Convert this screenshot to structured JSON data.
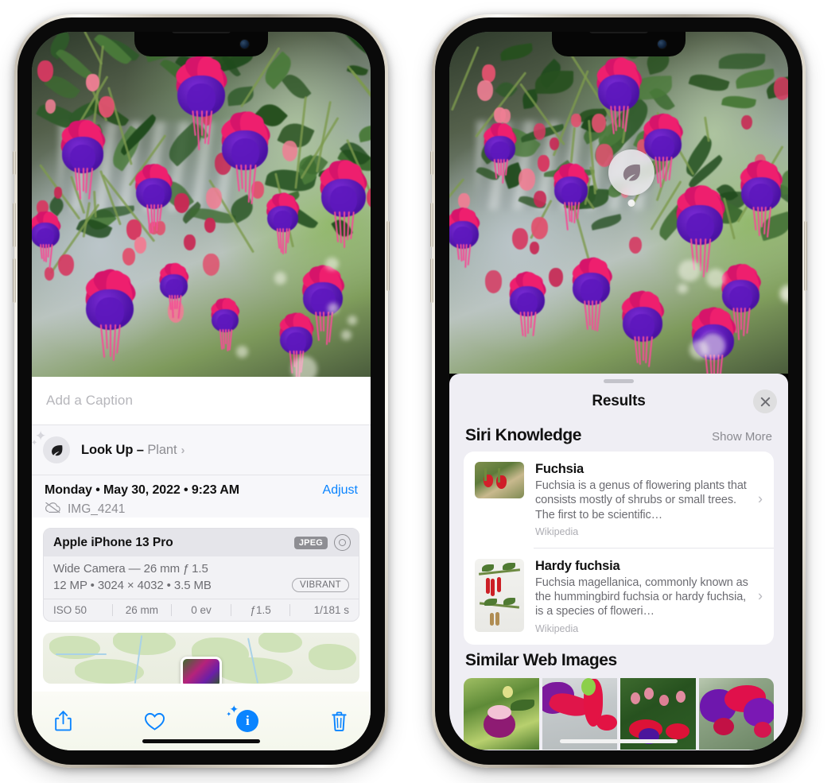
{
  "left_phone": {
    "name": "photos-info-view",
    "caption": {
      "placeholder": "Add a Caption",
      "value": ""
    },
    "lookup": {
      "label": "Look Up – ",
      "subject": "Plant",
      "chevron": "›",
      "icon": "leaf-icon"
    },
    "metadata": {
      "date": "Monday • May 30, 2022 • 9:23 AM",
      "adjust": "Adjust",
      "filename": "IMG_4241",
      "cloud_icon": "icloud-slash-icon"
    },
    "exif": {
      "model": "Apple iPhone 13 Pro",
      "format_tag": "JPEG",
      "aperture_icon": "aperture-icon",
      "lens_line": "Wide Camera — 26 mm ƒ 1.5",
      "size_line": "12 MP  •  3024 × 4032  •  3.5 MB",
      "style_tag": "VIBRANT",
      "stats": [
        "ISO 50",
        "26 mm",
        "0 ev",
        "ƒ1.5",
        "1/181 s"
      ]
    },
    "map": {
      "name": "location-map-thumbnail"
    },
    "toolbar": [
      {
        "name": "share-button",
        "icon": "share-icon"
      },
      {
        "name": "favorite-button",
        "icon": "heart-icon"
      },
      {
        "name": "info-button",
        "icon": "info-sparkle-icon",
        "glyph": "i"
      },
      {
        "name": "delete-button",
        "icon": "trash-icon"
      }
    ]
  },
  "right_phone": {
    "name": "visual-look-up-results",
    "badge": {
      "name": "leaf-subject-badge",
      "icon": "leaf-icon"
    },
    "sheet": {
      "title": "Results",
      "close_label": "×",
      "sections": [
        {
          "name": "siri-knowledge",
          "title": "Siri Knowledge",
          "action": "Show More",
          "items": [
            {
              "title": "Fuchsia",
              "description": "Fuchsia is a genus of flowering plants that consists mostly of shrubs or small trees. The first to be scientific…",
              "source": "Wikipedia",
              "thumb": "fuchsia-red-flowers-thumbnail"
            },
            {
              "title": "Hardy fuchsia",
              "description": "Fuchsia magellanica, commonly known as the hummingbird fuchsia or hardy fuchsia, is a species of floweri…",
              "source": "Wikipedia",
              "thumb": "hardy-fuchsia-branch-thumbnail"
            }
          ]
        },
        {
          "name": "similar-web-images",
          "title": "Similar Web Images",
          "images": [
            {
              "name": "web-image-1"
            },
            {
              "name": "web-image-2"
            },
            {
              "name": "web-image-3"
            },
            {
              "name": "web-image-4"
            }
          ]
        }
      ]
    }
  },
  "colors": {
    "accent_blue": "#0a84ff",
    "sheet_background": "#efeef4",
    "card_white": "#ffffff",
    "secondary_text": "#8e8e93",
    "tag_gray": "#8e8e93"
  }
}
